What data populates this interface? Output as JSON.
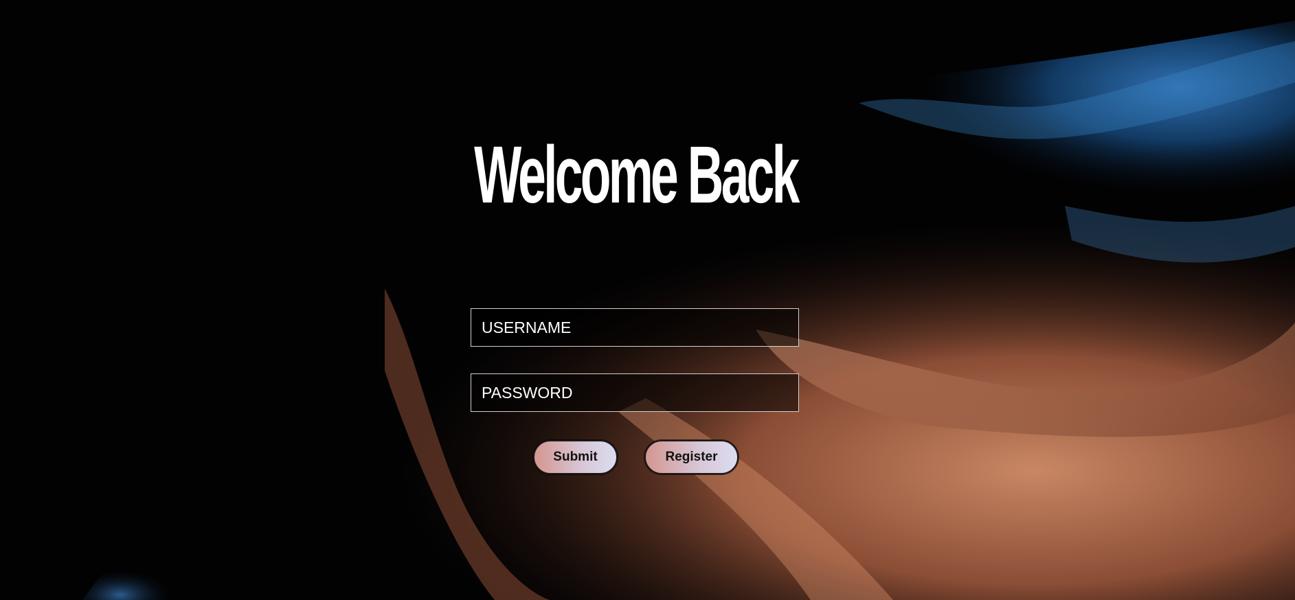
{
  "page": {
    "title": "Welcome Back"
  },
  "form": {
    "username_placeholder": "USERNAME",
    "password_placeholder": "PASSWORD",
    "submit_label": "Submit",
    "register_label": "Register"
  },
  "colors": {
    "text": "#ffffff",
    "field_border": "#d6d0cc",
    "button_gradient_start": "#d49690",
    "button_gradient_end": "#dcdcf0",
    "background": "#020203"
  }
}
